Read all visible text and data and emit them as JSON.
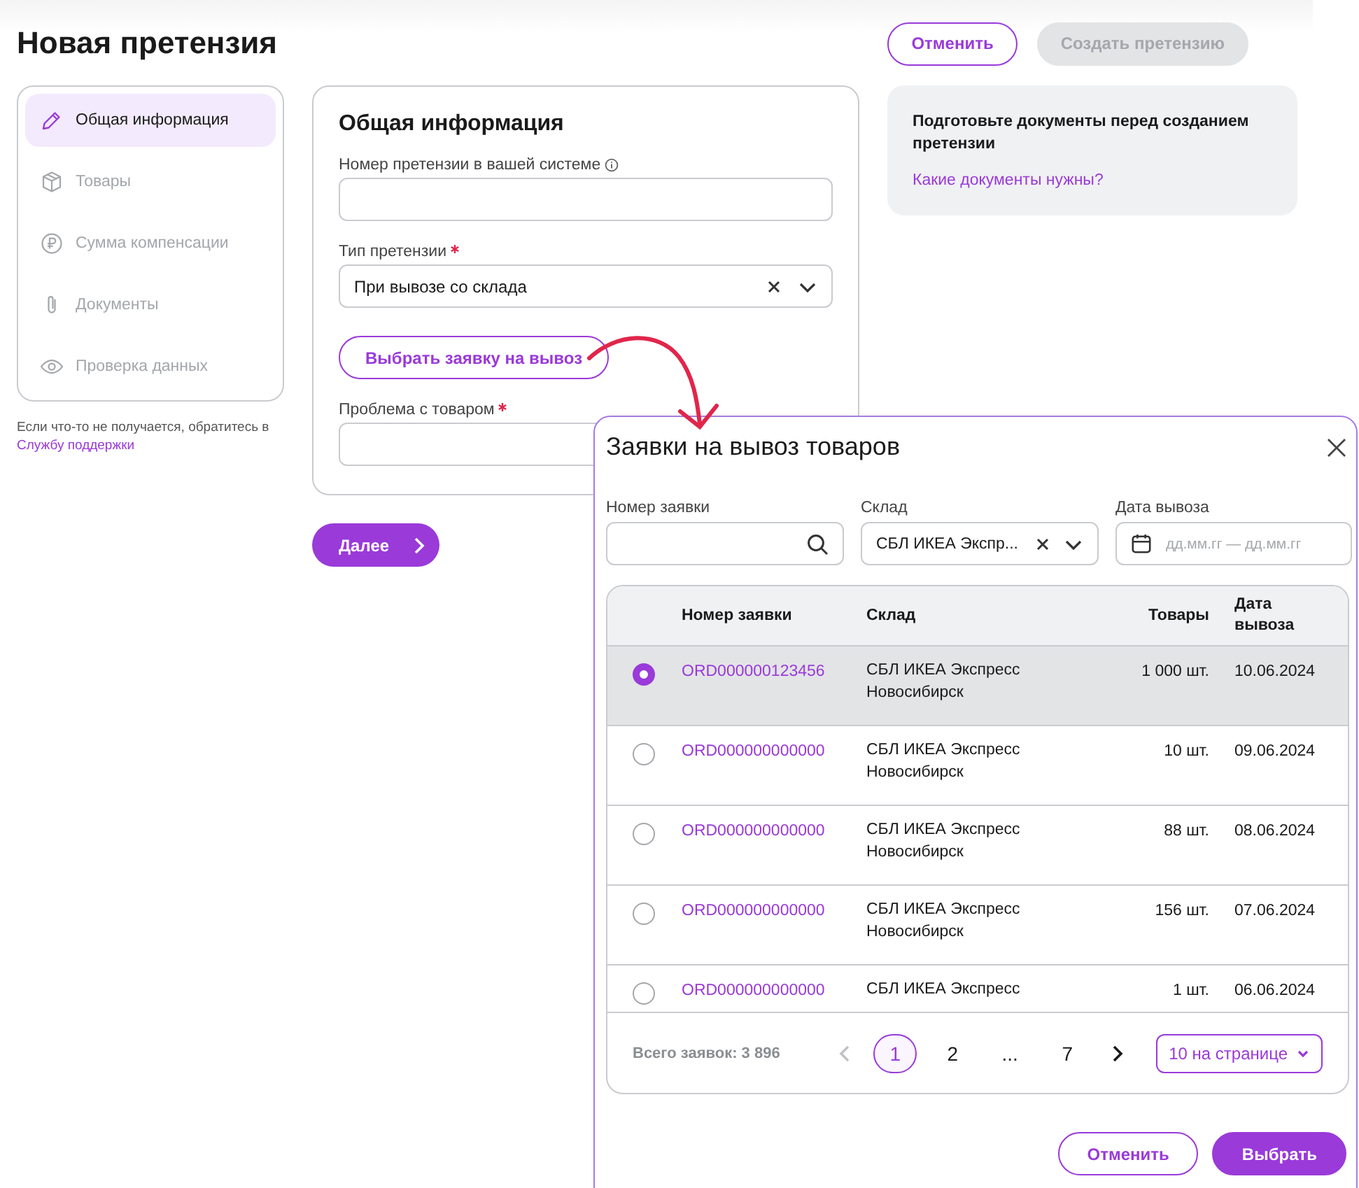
{
  "page": {
    "title": "Новая претензия"
  },
  "header_buttons": [
    {
      "label": "Отменить",
      "kind": "outline",
      "disabled": false
    },
    {
      "label": "Создать претензию",
      "kind": "filled",
      "disabled": true
    }
  ],
  "steps": [
    {
      "label": "Общая информация",
      "selected": true
    },
    {
      "label": "Товары",
      "selected": false
    },
    {
      "label": "Сумма компенсации",
      "selected": false
    },
    {
      "label": "Документы",
      "selected": false
    },
    {
      "label": "Проверка данных",
      "selected": false
    }
  ],
  "support_note": {
    "text": "Если что-то не получается, обратитесь в",
    "link": "Службу поддержки"
  },
  "form": {
    "title": "Общая информация",
    "fields": [
      {
        "kind": "text",
        "label": "Номер претензии в вашей системе",
        "required": false,
        "info": true
      },
      {
        "kind": "select",
        "label": "Тип претензии",
        "required": true,
        "info": false,
        "value": "При вывозе со склада"
      },
      {
        "kind": "button",
        "label": "Выбрать заявку на вывоз"
      },
      {
        "kind": "text",
        "label": "Проблема с товаром",
        "required": true,
        "info": false
      }
    ]
  },
  "next_button": {
    "label": "Далее"
  },
  "info_card": {
    "text": "Подготовьте документы перед созданием претензии",
    "link": "Какие документы нужны?"
  },
  "modal": {
    "title": "Заявки на вывоз товаров",
    "filters": [
      {
        "kind": "search",
        "label": "Номер заявки"
      },
      {
        "kind": "select",
        "label": "Склад",
        "value": "СБЛ ИКЕА Экспр..."
      },
      {
        "kind": "date",
        "label": "Дата вывоза",
        "placeholder": "дд.мм.гг — дд.мм.гг"
      }
    ],
    "table": {
      "columns": [
        "Номер заявки",
        "Склад",
        "Товары",
        "Дата вывоза"
      ],
      "rows": [
        {
          "selected": true,
          "number": "ORD000000123456",
          "warehouse": "СБЛ ИКЕА Экспресс Новосибирск",
          "goods": "1 000 шт.",
          "date": "10.06.2024"
        },
        {
          "selected": false,
          "number": "ORD000000000000",
          "warehouse": "СБЛ ИКЕА Экспресс Новосибирск",
          "goods": "10 шт.",
          "date": "09.06.2024"
        },
        {
          "selected": false,
          "number": "ORD000000000000",
          "warehouse": "СБЛ ИКЕА Экспресс Новосибирск",
          "goods": "88 шт.",
          "date": "08.06.2024"
        },
        {
          "selected": false,
          "number": "ORD000000000000",
          "warehouse": "СБЛ ИКЕА Экспресс Новосибирск",
          "goods": "156 шт.",
          "date": "07.06.2024"
        },
        {
          "selected": false,
          "number": "ORD000000000000",
          "warehouse": "СБЛ ИКЕА Экспресс",
          "goods": "1 шт.",
          "date": "06.06.2024"
        }
      ]
    },
    "total": "Всего заявок: 3 896",
    "pagination": {
      "prev": {
        "disabled": true
      },
      "next": {
        "disabled": false
      },
      "pages": [
        {
          "kind": "page",
          "label": "1",
          "selected": true
        },
        {
          "kind": "page",
          "label": "2",
          "selected": false
        },
        {
          "kind": "ellipsis",
          "label": "..."
        },
        {
          "kind": "page",
          "label": "7",
          "selected": false
        }
      ],
      "page_size": "10 на странице"
    },
    "buttons": [
      {
        "label": "Отменить",
        "kind": "outline"
      },
      {
        "label": "Выбрать",
        "kind": "filled"
      }
    ]
  }
}
